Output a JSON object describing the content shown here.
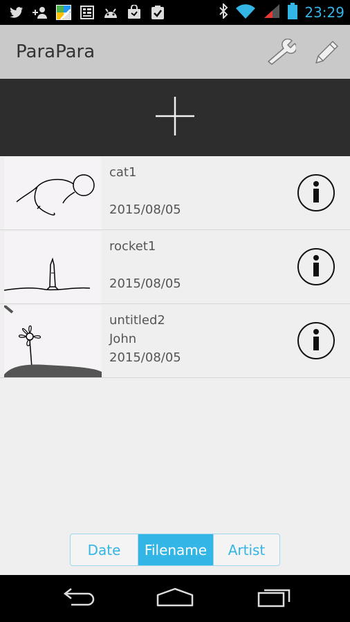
{
  "status_bar": {
    "time": "23:29",
    "icons": [
      "twitter-icon",
      "add-person-icon",
      "maps-icon",
      "keyboard-icon",
      "android-icon",
      "bag-icon",
      "checklist-icon",
      "bluetooth-icon",
      "wifi-icon",
      "signal-icon",
      "battery-icon"
    ],
    "accent": "#33b5e5"
  },
  "action_bar": {
    "title": "ParaPara",
    "actions": [
      "wrench-icon",
      "pencil-icon"
    ]
  },
  "new_button": {
    "icon": "plus-icon"
  },
  "files": [
    {
      "name": "cat1",
      "artist": "",
      "date": "2015/08/05"
    },
    {
      "name": "rocket1",
      "artist": "",
      "date": "2015/08/05"
    },
    {
      "name": "untitled2",
      "artist": "John",
      "date": "2015/08/05"
    }
  ],
  "sort": {
    "options": [
      "Date",
      "Filename",
      "Artist"
    ],
    "selected": "Filename"
  },
  "nav": [
    "back-icon",
    "home-icon",
    "recent-apps-icon"
  ]
}
